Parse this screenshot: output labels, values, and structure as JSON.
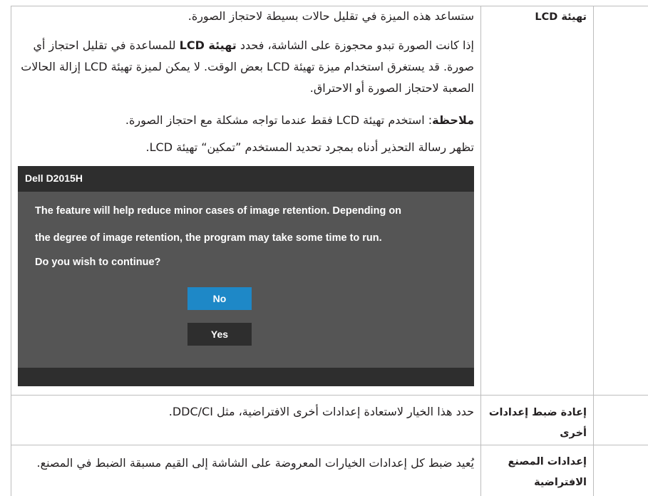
{
  "lcd_conditioning": {
    "label": "تهيئة LCD",
    "p1": "ستساعد هذه الميزة في تقليل حالات بسيطة لاحتجاز الصورة.",
    "p2_pre": "إذا كانت الصورة تبدو محجوزة على الشاشة، فحدد ",
    "p2_bold": "تهيئة LCD",
    "p2_post": " للمساعدة في تقليل احتجاز أي صورة. قد يستغرق استخدام ميزة تهيئة LCD بعض الوقت. لا يمكن لميزة تهيئة LCD إزالة الحالات الصعبة لاحتجاز الصورة أو الاحتراق.",
    "note_bold": "ملاحظة",
    "note_rest": ": استخدم تهيئة LCD فقط عندما تواجه مشكلة مع احتجاز الصورة.",
    "p4": "تظهر رسالة التحذير أدناه بمجرد تحديد المستخدم ”تمكين“ تهيئة LCD."
  },
  "dialog": {
    "title": "Dell D2015H",
    "line1": "The feature will help reduce minor cases of image retention. Depending on",
    "line2": "the degree of image retention, the program may take some time to run.",
    "line3": "Do you wish to continue?",
    "no_label": "No",
    "yes_label": "Yes",
    "colors": {
      "body": "#555555",
      "bar": "#2e2e2e",
      "no_button": "#1e88c7"
    }
  },
  "other_reset": {
    "label": "إعادة ضبط إعدادات أخرى",
    "desc": "حدد هذا الخيار لاستعادة إعدادات أخرى الافتراضية، مثل DDC/CI."
  },
  "factory_reset": {
    "label": "إعدادات المصنع الافتراضية",
    "desc": "يُعيد ضبط كل إعدادات الخيارات المعروضة على الشاشة إلى القيم مسبقة الضبط في المصنع."
  }
}
